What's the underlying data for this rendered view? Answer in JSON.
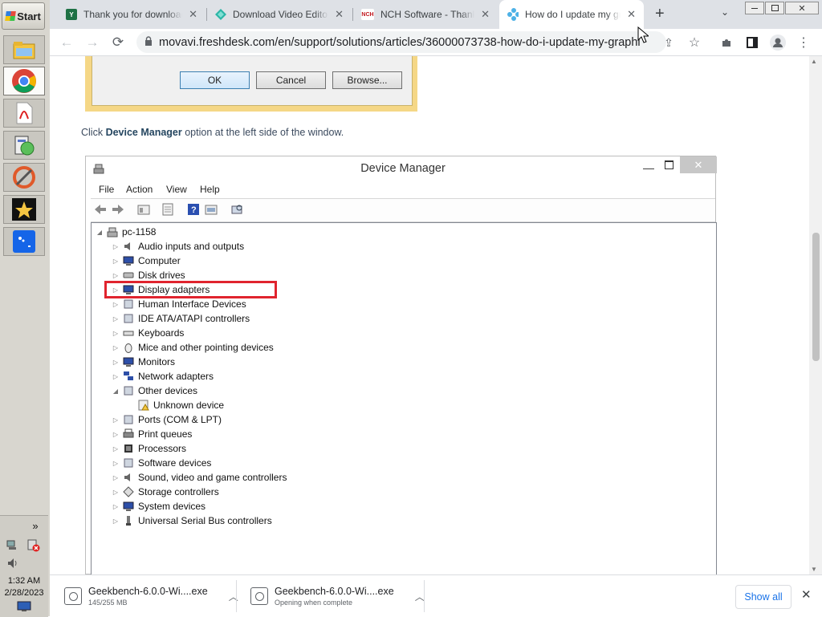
{
  "taskbar": {
    "start_label": "Start",
    "time": "1:32 AM",
    "date": "2/28/2023",
    "chevron": "»",
    "icons": [
      "folder-icon",
      "chrome-icon",
      "pdf-icon",
      "installer-icon",
      "cleaner-icon",
      "movie-star-icon",
      "app-blue-icon"
    ]
  },
  "browser": {
    "tabs": [
      {
        "title": "Thank you for downloading",
        "favicon": "spreadsheet-icon",
        "fav_color": "#1e7145"
      },
      {
        "title": "Download Video Editor F",
        "favicon": "movavi-icon",
        "fav_color": "#2bb5a6"
      },
      {
        "title": "NCH Software - Thank you",
        "favicon": "nch-icon",
        "fav_color": "#c0161d",
        "fav_text": "NCH"
      },
      {
        "title": "How do I update my graphic",
        "favicon": "freshdesk-icon",
        "fav_color": "#4db1e6",
        "active": true
      }
    ],
    "url": "movavi.freshdesk.com/en/support/solutions/articles/36000073738-how-do-i-update-my-graphic-..."
  },
  "dialog": {
    "ok": "OK",
    "cancel": "Cancel",
    "browse": "Browse..."
  },
  "article": {
    "instruction_prefix": "Click ",
    "instruction_bold": "Device Manager",
    "instruction_suffix": " option at the left side of the window."
  },
  "device_manager": {
    "title": "Device Manager",
    "menu": [
      "File",
      "Action",
      "View",
      "Help"
    ],
    "root": "pc-1158",
    "items": [
      "Audio inputs and outputs",
      "Computer",
      "Disk drives",
      "Display adapters",
      "Human Interface Devices",
      "IDE ATA/ATAPI controllers",
      "Keyboards",
      "Mice and other pointing devices",
      "Monitors",
      "Network adapters",
      "Other devices",
      "Unknown device",
      "Ports (COM & LPT)",
      "Print queues",
      "Processors",
      "Software devices",
      "Sound, video and game controllers",
      "Storage controllers",
      "System devices",
      "Universal Serial Bus controllers"
    ],
    "highlight_color": "#e0242e"
  },
  "downloads": {
    "items": [
      {
        "name": "Geekbench-6.0.0-Wi....exe",
        "status": "145/255 MB"
      },
      {
        "name": "Geekbench-6.0.0-Wi....exe",
        "status": "Opening when complete"
      }
    ],
    "show_all": "Show all"
  }
}
